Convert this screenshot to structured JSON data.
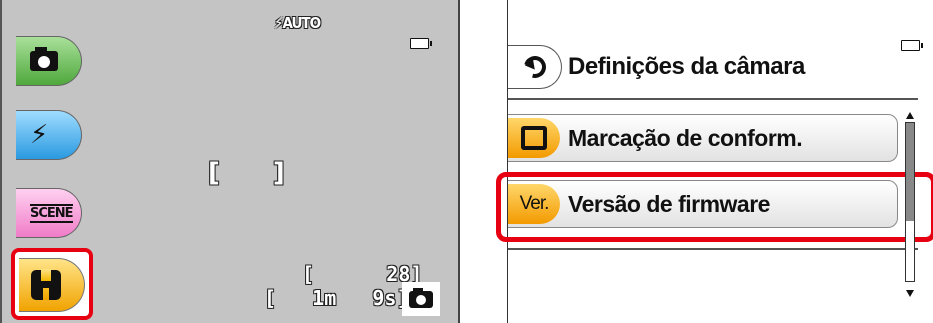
{
  "left_screen": {
    "flash_mode": "⚡AUTO",
    "af_brackets": "[ ]",
    "remaining_shots": "[      28]",
    "remaining_time": "[   1m   9s]",
    "tabs": [
      {
        "icon": "camera-icon"
      },
      {
        "icon": "flash-selftimer-icon",
        "glyph": "⚡"
      },
      {
        "icon": "scene-icon",
        "label": "SCENE"
      },
      {
        "icon": "wrench-icon",
        "selected": true
      }
    ],
    "shooting_mode_icon": "camera-icon"
  },
  "right_screen": {
    "title": "Definições da câmara",
    "items": [
      {
        "icon": "square-icon",
        "label": "Marcação de conform."
      },
      {
        "icon_text": "Ver.",
        "label": "Versão de firmware",
        "selected": true
      }
    ]
  },
  "colors": {
    "highlight": "#e60012",
    "tab_shoot": "#4fa83c",
    "tab_flash": "#2a9ae0",
    "tab_scene": "#f07cc8",
    "tab_setup": "#f1a300",
    "screen_bg": "#c4c4c4"
  }
}
